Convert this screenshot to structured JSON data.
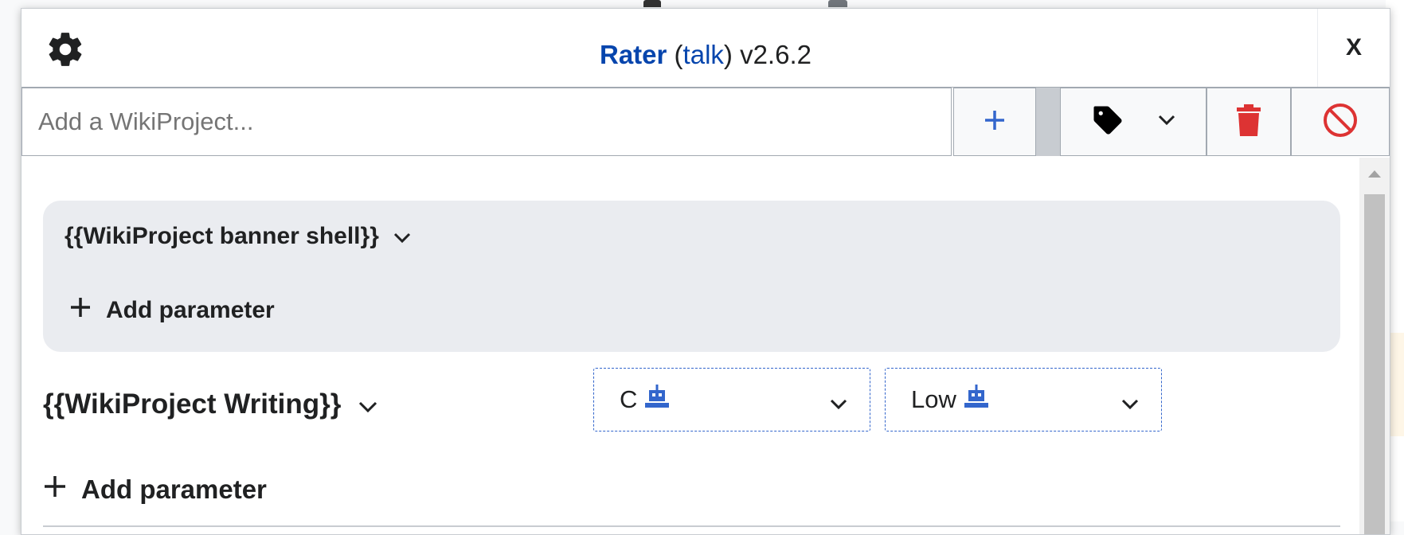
{
  "dialog": {
    "title_main": "Rater",
    "title_open_paren": " (",
    "title_talk": "talk",
    "title_close_paren": ")",
    "title_version": " v2.6.2",
    "close_label": "X"
  },
  "toolbar": {
    "add_input_placeholder": "Add a WikiProject...",
    "add_button_icon": "plus-icon",
    "tag_button_icon": "tag-icon",
    "remove_button_icon": "trash-icon",
    "cancel_button_icon": "cancel-icon"
  },
  "banners": {
    "shell": {
      "name": "{{WikiProject banner shell}}",
      "add_parameter": "Add parameter"
    },
    "project": {
      "name": "{{WikiProject Writing}}",
      "class_value": "C",
      "importance_value": "Low",
      "add_parameter": "Add parameter"
    }
  },
  "colors": {
    "link": "#0645ad",
    "accent": "#3366cc",
    "destructive": "#d33"
  }
}
